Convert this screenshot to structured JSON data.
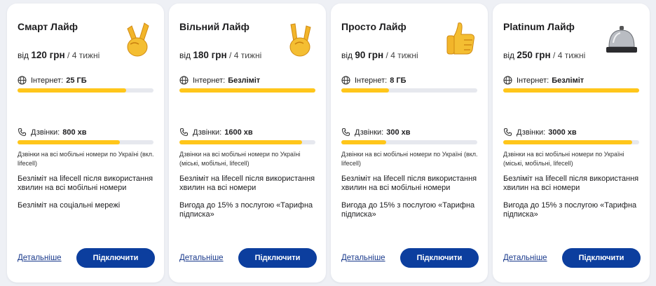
{
  "colors": {
    "accent_yellow": "#ffc61a",
    "button_blue": "#0c3e9e",
    "link_blue": "#1a3a8c",
    "bar_track": "#e6e8ee"
  },
  "labels": {
    "internet": "Інтернет:",
    "calls": "Дзвінки:"
  },
  "cards": [
    {
      "title": "Смарт Лайф",
      "price_prefix": "від",
      "price": "120 грн",
      "period": "/ 4 тижні",
      "icon": "victory-hand-icon",
      "internet_value": "25 ГБ",
      "internet_fill": 0.8,
      "calls_value": "800 хв",
      "calls_fill": 0.75,
      "note": "Дзвінки на всі мобільні номери по Україні (вкл. lifecell)",
      "feature_1": "Безліміт на lifecell після використання хвилин на всі мобільні номери",
      "feature_2": "Безліміт на соціальні мережі",
      "details": "Детальніше",
      "connect": "Підключити"
    },
    {
      "title": "Вільний Лайф",
      "price_prefix": "від",
      "price": "180 грн",
      "period": "/ 4 тижні",
      "icon": "rock-hand-icon",
      "internet_value": "Безліміт",
      "internet_fill": 1.0,
      "calls_value": "1600 хв",
      "calls_fill": 0.9,
      "note": "Дзвінки на всі мобільні номери по Україні (міські, мобільні, lifecell)",
      "feature_1": "Безліміт на lifecell після використання хвилин на всі номери",
      "feature_2": "Вигода до 15% з послугою «Тарифна підписка»",
      "details": "Детальніше",
      "connect": "Підключити"
    },
    {
      "title": "Просто Лайф",
      "price_prefix": "від",
      "price": "90 грн",
      "period": "/ 4 тижні",
      "icon": "thumbs-up-icon",
      "internet_value": "8 ГБ",
      "internet_fill": 0.35,
      "calls_value": "300 хв",
      "calls_fill": 0.33,
      "note": "Дзвінки на всі мобільні номери по Україні (вкл. lifecell)",
      "feature_1": "Безліміт на lifecell після використання хвилин на всі мобільні номери",
      "feature_2": "Вигода до 15% з послугою «Тарифна підписка»",
      "details": "Детальніше",
      "connect": "Підключити"
    },
    {
      "title": "Platinum Лайф",
      "price_prefix": "від",
      "price": "250 грн",
      "period": "/ 4 тижні",
      "icon": "service-bell-icon",
      "internet_value": "Безліміт",
      "internet_fill": 1.0,
      "calls_value": "3000 хв",
      "calls_fill": 0.95,
      "note": "Дзвінки на всі мобільні номери по Україні (міські, мобільні, lifecell)",
      "feature_1": "Безліміт на lifecell після використання хвилин на всі номери",
      "feature_2": "Вигода до 15% з послугою «Тарифна підписка»",
      "details": "Детальніше",
      "connect": "Підключити"
    }
  ]
}
